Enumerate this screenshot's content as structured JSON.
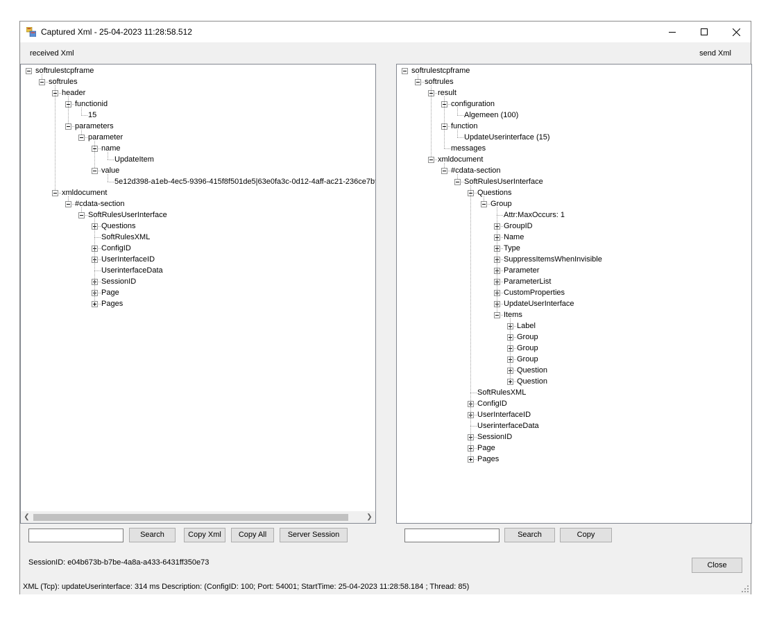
{
  "window": {
    "title": "Captured Xml - 25-04-2023 11:28:58.512",
    "minimize_glyph": "—",
    "maximize_glyph": "☐",
    "close_glyph": "✕"
  },
  "left": {
    "label": "received Xml",
    "search_value": "",
    "buttons": {
      "search": "Search",
      "copy_xml": "Copy Xml",
      "copy_all": "Copy All",
      "server_session": "Server Session"
    },
    "tree": [
      {
        "d": 0,
        "t": "softrulestcpframe",
        "e": "minus"
      },
      {
        "d": 1,
        "t": "softrules",
        "e": "minus"
      },
      {
        "d": 2,
        "t": "header",
        "e": "minus"
      },
      {
        "d": 3,
        "t": "functionid",
        "e": "minus"
      },
      {
        "d": 4,
        "t": "15",
        "e": "none"
      },
      {
        "d": 3,
        "t": "parameters",
        "e": "minus"
      },
      {
        "d": 4,
        "t": "parameter",
        "e": "minus"
      },
      {
        "d": 5,
        "t": "name",
        "e": "minus"
      },
      {
        "d": 6,
        "t": "UpdateItem",
        "e": "none"
      },
      {
        "d": 5,
        "t": "value",
        "e": "minus"
      },
      {
        "d": 6,
        "t": "5e12d398-a1eb-4ec5-9396-415f8f501de5|63e0fa3c-0d12-4aff-ac21-236ce7bfc",
        "e": "none"
      },
      {
        "d": 2,
        "t": "xmldocument",
        "e": "minus"
      },
      {
        "d": 3,
        "t": "#cdata-section",
        "e": "minus"
      },
      {
        "d": 4,
        "t": "SoftRulesUserInterface",
        "e": "minus"
      },
      {
        "d": 5,
        "t": "Questions",
        "e": "plus"
      },
      {
        "d": 5,
        "t": "SoftRulesXML",
        "e": "none"
      },
      {
        "d": 5,
        "t": "ConfigID",
        "e": "plus"
      },
      {
        "d": 5,
        "t": "UserInterfaceID",
        "e": "plus"
      },
      {
        "d": 5,
        "t": "UserinterfaceData",
        "e": "none"
      },
      {
        "d": 5,
        "t": "SessionID",
        "e": "plus"
      },
      {
        "d": 5,
        "t": "Page",
        "e": "plus"
      },
      {
        "d": 5,
        "t": "Pages",
        "e": "plus"
      }
    ]
  },
  "right": {
    "label": "send Xml",
    "search_value": "",
    "buttons": {
      "search": "Search",
      "copy": "Copy"
    },
    "tree": [
      {
        "d": 0,
        "t": "softrulestcpframe",
        "e": "minus"
      },
      {
        "d": 1,
        "t": "softrules",
        "e": "minus"
      },
      {
        "d": 2,
        "t": "result",
        "e": "minus"
      },
      {
        "d": 3,
        "t": "configuration",
        "e": "minus"
      },
      {
        "d": 4,
        "t": "Algemeen (100)",
        "e": "none"
      },
      {
        "d": 3,
        "t": "function",
        "e": "minus"
      },
      {
        "d": 4,
        "t": "UpdateUserinterface (15)",
        "e": "none"
      },
      {
        "d": 3,
        "t": "messages",
        "e": "none"
      },
      {
        "d": 2,
        "t": "xmldocument",
        "e": "minus"
      },
      {
        "d": 3,
        "t": "#cdata-section",
        "e": "minus"
      },
      {
        "d": 4,
        "t": "SoftRulesUserInterface",
        "e": "minus"
      },
      {
        "d": 5,
        "t": "Questions",
        "e": "minus"
      },
      {
        "d": 6,
        "t": "Group",
        "e": "minus"
      },
      {
        "d": 7,
        "t": "Attr:MaxOccurs: 1",
        "e": "none"
      },
      {
        "d": 7,
        "t": "GroupID",
        "e": "plus"
      },
      {
        "d": 7,
        "t": "Name",
        "e": "plus"
      },
      {
        "d": 7,
        "t": "Type",
        "e": "plus"
      },
      {
        "d": 7,
        "t": "SuppressItemsWhenInvisible",
        "e": "plus"
      },
      {
        "d": 7,
        "t": "Parameter",
        "e": "plus"
      },
      {
        "d": 7,
        "t": "ParameterList",
        "e": "plus"
      },
      {
        "d": 7,
        "t": "CustomProperties",
        "e": "plus"
      },
      {
        "d": 7,
        "t": "UpdateUserInterface",
        "e": "plus"
      },
      {
        "d": 7,
        "t": "Items",
        "e": "minus"
      },
      {
        "d": 8,
        "t": "Label",
        "e": "plus"
      },
      {
        "d": 8,
        "t": "Group",
        "e": "plus"
      },
      {
        "d": 8,
        "t": "Group",
        "e": "plus"
      },
      {
        "d": 8,
        "t": "Group",
        "e": "plus"
      },
      {
        "d": 8,
        "t": "Question",
        "e": "plus"
      },
      {
        "d": 8,
        "t": "Question",
        "e": "plus"
      },
      {
        "d": 5,
        "t": "SoftRulesXML",
        "e": "none"
      },
      {
        "d": 5,
        "t": "ConfigID",
        "e": "plus"
      },
      {
        "d": 5,
        "t": "UserInterfaceID",
        "e": "plus"
      },
      {
        "d": 5,
        "t": "UserinterfaceData",
        "e": "none"
      },
      {
        "d": 5,
        "t": "SessionID",
        "e": "plus"
      },
      {
        "d": 5,
        "t": "Page",
        "e": "plus"
      },
      {
        "d": 5,
        "t": "Pages",
        "e": "plus"
      }
    ]
  },
  "session": {
    "text": "SessionID: e04b673b-b7be-4a8a-a433-6431ff350e73"
  },
  "close_button": "Close",
  "status": {
    "text": "XML (Tcp): updateUserinterface: 314 ms Description:  (ConfigID: 100; Port: 54001; StartTime: 25-04-2023 11:28:58.184 ; Thread: 85)"
  }
}
